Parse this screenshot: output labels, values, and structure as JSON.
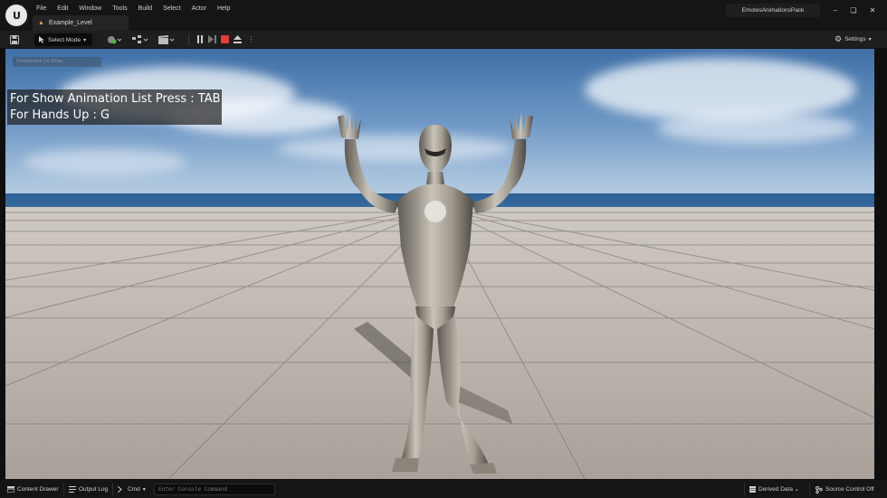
{
  "menu": [
    "File",
    "Edit",
    "Window",
    "Tools",
    "Build",
    "Select",
    "Actor",
    "Help"
  ],
  "level_tab": {
    "label": "Example_Level"
  },
  "project_name": "EmotesAnimationsPack",
  "toolbar": {
    "select_mode_label": "Select Mode",
    "settings_label": "Settings"
  },
  "viewport": {
    "badge_text": "Perspective  Lit  Show",
    "hint_lines": [
      "For Show Animation List Press : TAB",
      "For Hands Up : G"
    ]
  },
  "statusbar": {
    "content_drawer": "Content Drawer",
    "output_log": "Output Log",
    "cmd": "Cmd",
    "console_placeholder": "Enter Console Command",
    "derived_data": "Derived Data",
    "source_control": "Source Control Off"
  },
  "colors": {
    "accent_stop": "#e23b3b",
    "accent_play": "#8a8a8a",
    "accent_level_icon": "#e0a040"
  },
  "icons": {
    "logo": "unreal-logo-icon",
    "save": "save-icon",
    "add": "add-actor-icon",
    "blueprint": "blueprint-icon",
    "cinematics": "clapper-icon",
    "pause": "pause-icon",
    "step": "step-icon",
    "stop": "stop-icon",
    "eject": "eject-icon",
    "more": "more-icon",
    "settings": "gear-icon"
  }
}
